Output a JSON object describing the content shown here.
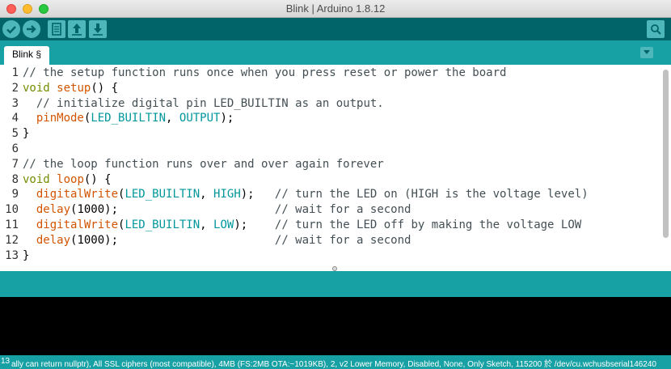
{
  "window": {
    "title": "Blink | Arduino 1.8.12"
  },
  "toolbar": {
    "verify": "verify-icon",
    "upload": "upload-arrow-icon",
    "new": "new-sketch-icon",
    "open": "open-sketch-icon",
    "save": "save-sketch-icon",
    "serial": "serial-monitor-icon"
  },
  "tabs": [
    {
      "label": "Blink §"
    }
  ],
  "editor": {
    "lines": [
      {
        "n": "1",
        "tokens": [
          [
            "cm",
            "// the setup function runs once when you press reset or power the board"
          ]
        ]
      },
      {
        "n": "2",
        "tokens": [
          [
            "kw",
            "void"
          ],
          [
            "",
            " "
          ],
          [
            "fn",
            "setup"
          ],
          [
            "",
            "() {"
          ]
        ]
      },
      {
        "n": "3",
        "tokens": [
          [
            "",
            "  "
          ],
          [
            "cm",
            "// initialize digital pin LED_BUILTIN as an output."
          ]
        ]
      },
      {
        "n": "4",
        "tokens": [
          [
            "",
            "  "
          ],
          [
            "fn",
            "pinMode"
          ],
          [
            "",
            "("
          ],
          [
            "cst",
            "LED_BUILTIN"
          ],
          [
            "",
            ", "
          ],
          [
            "cst",
            "OUTPUT"
          ],
          [
            "",
            ");"
          ]
        ]
      },
      {
        "n": "5",
        "tokens": [
          [
            "",
            "}"
          ]
        ]
      },
      {
        "n": "6",
        "tokens": [
          [
            "",
            ""
          ]
        ]
      },
      {
        "n": "7",
        "tokens": [
          [
            "cm",
            "// the loop function runs over and over again forever"
          ]
        ]
      },
      {
        "n": "8",
        "tokens": [
          [
            "kw",
            "void"
          ],
          [
            "",
            " "
          ],
          [
            "fn",
            "loop"
          ],
          [
            "",
            "() {"
          ]
        ]
      },
      {
        "n": "9",
        "tokens": [
          [
            "",
            "  "
          ],
          [
            "fn",
            "digitalWrite"
          ],
          [
            "",
            "("
          ],
          [
            "cst",
            "LED_BUILTIN"
          ],
          [
            "",
            ", "
          ],
          [
            "cst",
            "HIGH"
          ],
          [
            "",
            ");   "
          ],
          [
            "cm",
            "// turn the LED on (HIGH is the voltage level)"
          ]
        ]
      },
      {
        "n": "10",
        "tokens": [
          [
            "",
            "  "
          ],
          [
            "fn",
            "delay"
          ],
          [
            "",
            "(1000);                       "
          ],
          [
            "cm",
            "// wait for a second"
          ]
        ]
      },
      {
        "n": "11",
        "tokens": [
          [
            "",
            "  "
          ],
          [
            "fn",
            "digitalWrite"
          ],
          [
            "",
            "("
          ],
          [
            "cst",
            "LED_BUILTIN"
          ],
          [
            "",
            ", "
          ],
          [
            "cst",
            "LOW"
          ],
          [
            "",
            ");    "
          ],
          [
            "cm",
            "// turn the LED off by making the voltage LOW"
          ]
        ]
      },
      {
        "n": "12",
        "tokens": [
          [
            "",
            "  "
          ],
          [
            "fn",
            "delay"
          ],
          [
            "",
            "(1000);                       "
          ],
          [
            "cm",
            "// wait for a second"
          ]
        ]
      },
      {
        "n": "13",
        "tokens": [
          [
            "",
            "}"
          ]
        ]
      }
    ]
  },
  "status": {
    "line_number": "13",
    "board_info": "ally can return nullptr), All SSL ciphers (most compatible), 4MB (FS:2MB OTA:~1019KB), 2, v2 Lower Memory, Disabled, None, Only Sketch, 115200 於 /dev/cu.wchusbserial146240"
  }
}
